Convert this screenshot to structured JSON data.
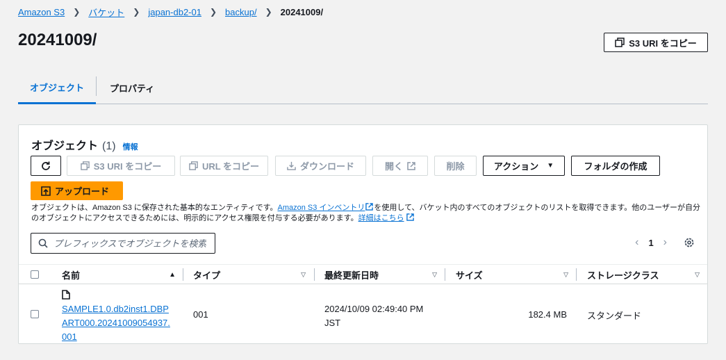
{
  "breadcrumb": {
    "items": [
      "Amazon S3",
      "バケット",
      "japan-db2-01",
      "backup/"
    ],
    "current": "20241009/"
  },
  "page": {
    "title": "20241009/",
    "copy_uri_label": "S3 URI をコピー"
  },
  "tabs": [
    {
      "label": "オブジェクト",
      "active": true
    },
    {
      "label": "プロパティ",
      "active": false
    }
  ],
  "objects_panel": {
    "title": "オブジェクト",
    "count": "(1)",
    "info_label": "情報",
    "toolbar": {
      "copy_s3_uri": "S3 URI をコピー",
      "copy_url": "URL をコピー",
      "download": "ダウンロード",
      "open": "開く",
      "delete": "削除",
      "actions": "アクション",
      "create_folder": "フォルダの作成",
      "upload": "アップロード"
    },
    "description": {
      "part1": "オブジェクトは、Amazon S3 に保存された基本的なエンティティです。",
      "inventory_link": "Amazon S3 インベントリ",
      "part2": "を使用して、バケット内のすべてのオブジェクトのリストを取得できます。他のユーザーが自分のオブジェクトにアクセスできるためには、明示的にアクセス権限を付与する必要があります。",
      "learn_more_link": "詳細はこちら"
    },
    "search": {
      "placeholder": "プレフィックスでオブジェクトを検索"
    },
    "pagination": {
      "current_page": "1"
    },
    "columns": [
      "名前",
      "タイプ",
      "最終更新日時",
      "サイズ",
      "ストレージクラス"
    ],
    "rows": [
      {
        "name": "SAMPLE1.0.db2inst1.DBPART000.20241009054937.001",
        "type": "001",
        "last_modified_line1": "2024/10/09 02:49:40 PM",
        "last_modified_line2": "JST",
        "size": "182.4 MB",
        "storage_class": "スタンダード"
      }
    ]
  },
  "colors": {
    "link": "#0972d3",
    "primary": "#ff9900",
    "background": "#f2f2f2"
  }
}
